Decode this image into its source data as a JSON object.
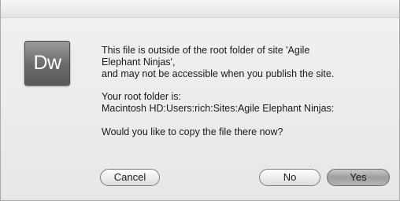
{
  "icon": {
    "name": "dreamweaver-app-icon",
    "label": "Dw"
  },
  "message": {
    "line1": "This file is outside of the root folder of site 'Agile",
    "line2": "Elephant Ninjas',",
    "line3": "and may not be accessible when you publish the site.",
    "root_label": "Your root folder is:",
    "root_path": "Macintosh HD:Users:rich:Sites:Agile Elephant Ninjas:",
    "question": "Would you like to copy the file there now?"
  },
  "buttons": {
    "cancel": "Cancel",
    "no": "No",
    "yes": "Yes"
  }
}
